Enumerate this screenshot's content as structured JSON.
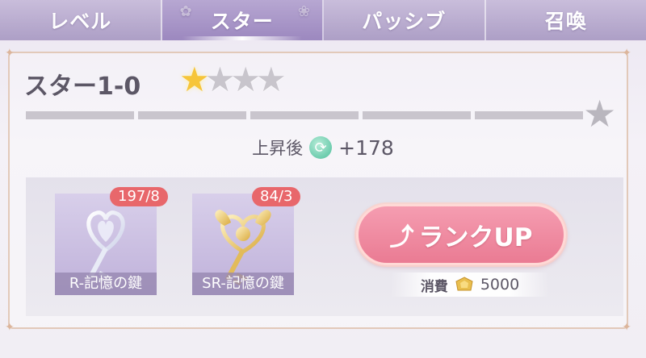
{
  "tabs": [
    {
      "label": "レベル",
      "active": false
    },
    {
      "label": "スター",
      "active": true
    },
    {
      "label": "パッシブ",
      "active": false
    },
    {
      "label": "召喚",
      "active": false
    }
  ],
  "star_panel": {
    "title": "スター1-0",
    "stars_filled": 1,
    "stars_total": 4,
    "progress_segments_total": 5,
    "progress_segments_filled": 0,
    "after_label": "上昇後",
    "after_value": "+178"
  },
  "materials": [
    {
      "count": "197/8",
      "name": "R-記憶の鍵",
      "icon": "silver-key-icon"
    },
    {
      "count": "84/3",
      "name": "SR-記憶の鍵",
      "icon": "gold-key-icon"
    }
  ],
  "rank_up": {
    "label": "ランクUP",
    "cost_label": "消費",
    "cost_value": "5000",
    "cost_icon": "gold-coin-icon"
  },
  "colors": {
    "tab_bg": "#ad9fc6",
    "badge": "#e8676b",
    "button": "#ea7b93",
    "star_on": "#f6c53a",
    "star_off": "#c8c5cc"
  }
}
